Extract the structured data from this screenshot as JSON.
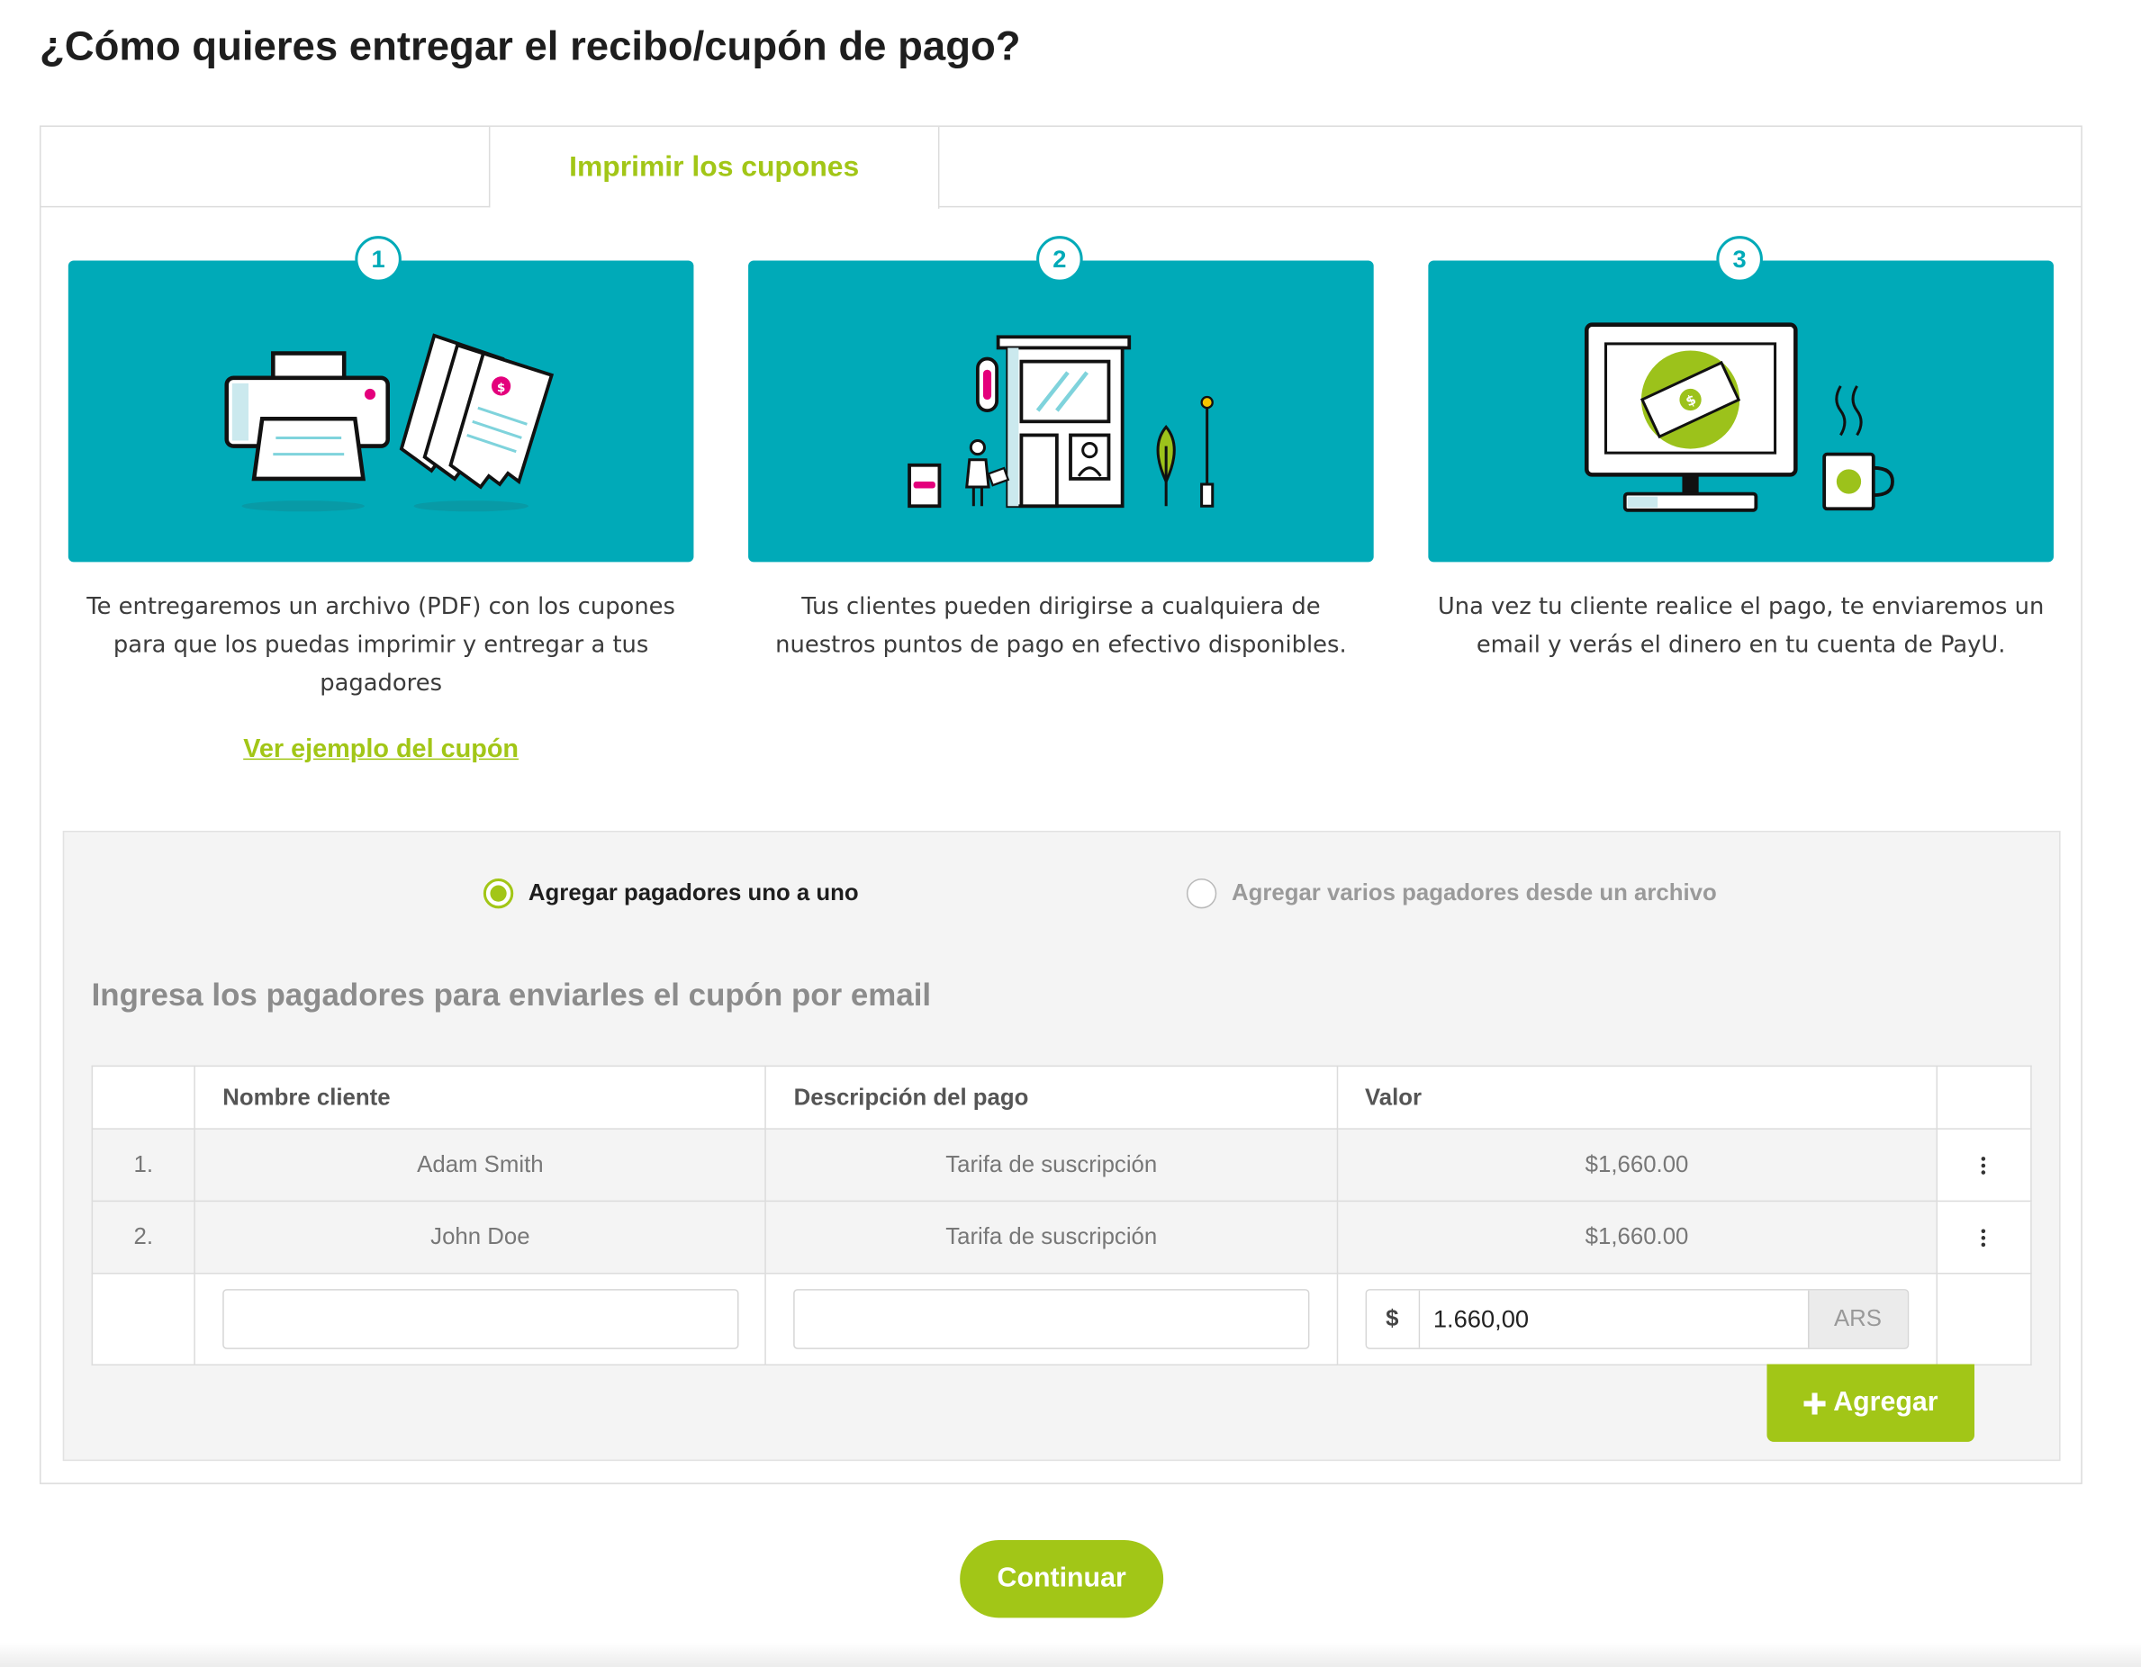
{
  "page": {
    "title": "¿Cómo quieres entregar el recibo/cupón de pago?"
  },
  "tabs": [
    {
      "label": ""
    },
    {
      "label": "Imprimir los cupones",
      "active": true
    }
  ],
  "steps": [
    {
      "number": "1",
      "text": "Te entregaremos un archivo (PDF) con los cupones para que los puedas imprimir y entregar a tus pagadores",
      "icon": "printer-coupons-illustration"
    },
    {
      "number": "2",
      "text": "Tus clientes pueden dirigirse a cualquiera de nuestros puntos de pago en efectivo disponibles.",
      "icon": "payment-point-store-illustration"
    },
    {
      "number": "3",
      "text": "Una vez tu cliente realice el pago, te enviaremos un email y verás el dinero en tu cuenta de PayU.",
      "icon": "monitor-money-illustration"
    }
  ],
  "example_link": "Ver ejemplo del cupón",
  "mode": {
    "options": [
      {
        "label": "Agregar pagadores uno a uno",
        "selected": true
      },
      {
        "label": "Agregar varios pagadores desde un archivo",
        "selected": false
      }
    ]
  },
  "payers": {
    "heading": "Ingresa los pagadores para enviarles el cupón por email",
    "columns": [
      "Nombre cliente",
      "Descripción del pago",
      "Valor"
    ],
    "rows": [
      {
        "index": "1.",
        "name": "Adam Smith",
        "description": "Tarifa de suscripción",
        "value": "$1,660.00"
      },
      {
        "index": "2.",
        "name": "John Doe",
        "description": "Tarifa de suscripción",
        "value": "$1,660.00"
      }
    ],
    "new_entry": {
      "name": "",
      "description": "",
      "currency_symbol": "$",
      "amount": "1.660,00",
      "currency_code": "ARS"
    },
    "add_label": "Agregar",
    "add_icon": "plus-icon"
  },
  "continue_label": "Continuar",
  "colors": {
    "accent": "#a2c617",
    "teal": "#00aab8",
    "panel_gray": "#f4f4f4"
  }
}
